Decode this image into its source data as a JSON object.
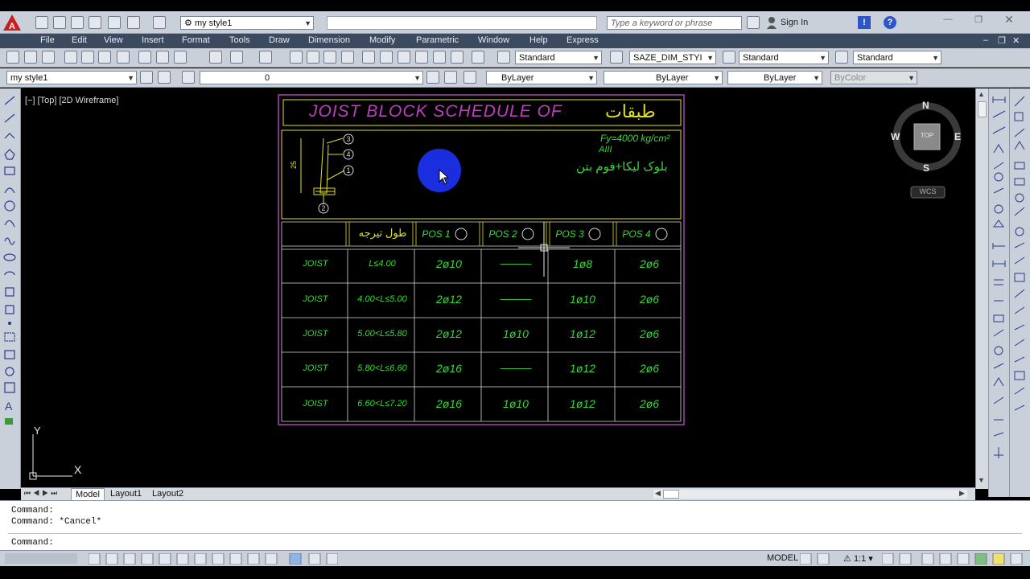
{
  "title_bar": {
    "workspace": "my style1",
    "search_placeholder": "Type a keyword or phrase",
    "sign_in": "Sign In"
  },
  "menu": [
    "File",
    "Edit",
    "View",
    "Insert",
    "Format",
    "Tools",
    "Draw",
    "Dimension",
    "Modify",
    "Parametric",
    "Window",
    "Help",
    "Express"
  ],
  "toolbar1": {
    "text_style": "Standard",
    "dim_style": "SAZE_DIM_STYI",
    "table_style": "Standard",
    "mleader_style": "Standard"
  },
  "toolbar2": {
    "workspace": "my style1",
    "layer": "0",
    "color": "ByLayer",
    "linetype": "ByLayer",
    "lineweight": "ByLayer",
    "plotstyle": "ByColor"
  },
  "viewport_label": "[−] [Top] [2D Wireframe]",
  "viewcube": {
    "n": "N",
    "s": "S",
    "e": "E",
    "w": "W",
    "top": "TOP",
    "wcs": "WCS"
  },
  "ucs": {
    "x": "X",
    "y": "Y"
  },
  "drawing": {
    "title_latin": "JOIST  BLOCK  SCHEDULE  OF",
    "title_arabic": "طبقات",
    "fy": "Fy=4000 kg/cm²",
    "aiii": "AIII",
    "block_note": "بلوک لیکا+فوم بتن",
    "dim_25": "25",
    "callouts": [
      "3",
      "4",
      "1",
      "2"
    ],
    "headers": [
      "",
      "طول تیرجه",
      "POS  1",
      "POS  2",
      "POS  3",
      "POS  4"
    ],
    "rows": [
      [
        "JOIST",
        "L≤4.00",
        "2ø10",
        "———",
        "1ø8",
        "2ø6"
      ],
      [
        "JOIST",
        "4.00<L≤5.00",
        "2ø12",
        "———",
        "1ø10",
        "2ø6"
      ],
      [
        "JOIST",
        "5.00<L≤5.80",
        "2ø12",
        "1ø10",
        "1ø12",
        "2ø6"
      ],
      [
        "JOIST",
        "5.80<L≤6.60",
        "2ø16",
        "———",
        "1ø12",
        "2ø6"
      ],
      [
        "JOIST",
        "6.60<L≤7.20",
        "2ø16",
        "1ø10",
        "1ø12",
        "2ø6"
      ]
    ]
  },
  "layout_tabs": [
    "Model",
    "Layout1",
    "Layout2"
  ],
  "command_lines": [
    "Command:",
    "Command: *Cancel*",
    "Command:"
  ],
  "status": {
    "model": "MODEL",
    "scale": "1:1"
  },
  "colors": {
    "title_magenta": "#c03cc0",
    "cad_green": "#38d838",
    "cad_yellow": "#e0e020",
    "frame_magenta": "#b040b0"
  }
}
